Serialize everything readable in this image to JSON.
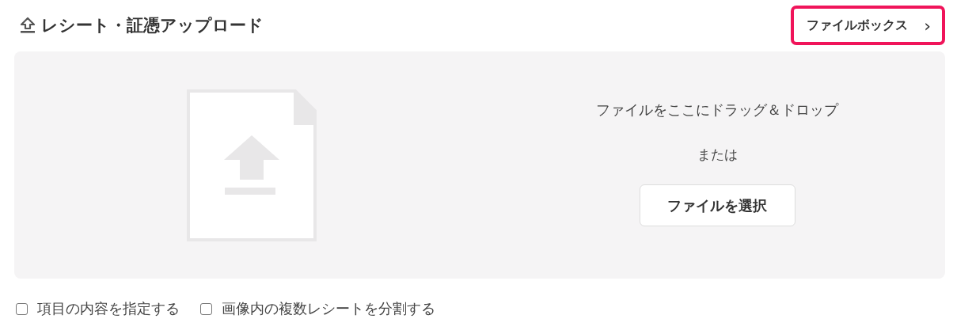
{
  "header": {
    "title": "レシート・証憑アップロード",
    "link": "ファイルボックス",
    "link_chevron": "›"
  },
  "dropzone": {
    "instruction": "ファイルをここにドラッグ＆ドロップ",
    "separator": "または",
    "button": "ファイルを選択"
  },
  "options": [
    {
      "label": "項目の内容を指定する",
      "checked": false
    },
    {
      "label": "画像内の複数レシートを分割する",
      "checked": false
    }
  ]
}
